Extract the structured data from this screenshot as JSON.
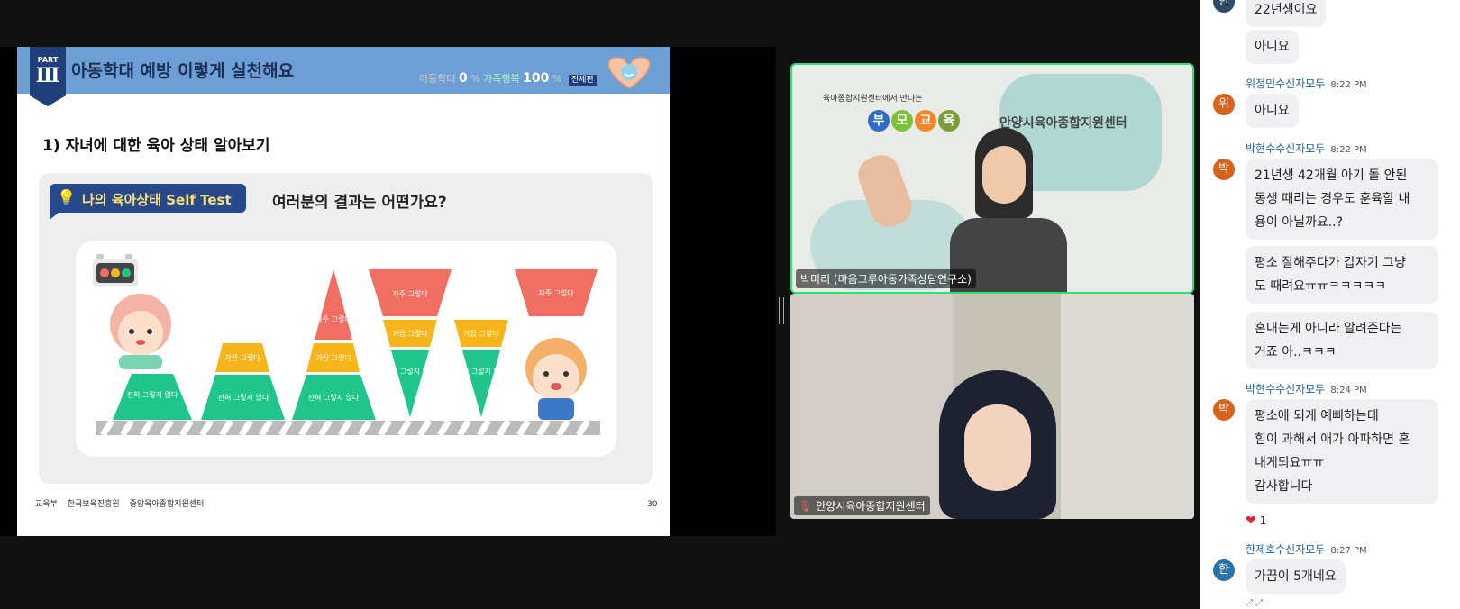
{
  "slide": {
    "part_label": "PART",
    "part_number": "Ⅲ",
    "title": "아동학대 예방 이렇게 실천해요",
    "stats": {
      "abuse_label": "아동학대",
      "abuse_value": "0",
      "abuse_unit": "%",
      "happy_label": "가족행복",
      "happy_value": "100",
      "happy_unit": "%",
      "badge": "전체편"
    },
    "subtitle": "1) 자녀에 대한 육아 상태 알아보기",
    "selftest_label": "나의 육아상태 Self Test",
    "question": "여러분의 결과는 어떤가요?",
    "shape_labels": {
      "never": "전혀 그렇지 않다",
      "sometimes": "가끔 그렇다",
      "often": "자주 그렇다",
      "never_split": "전혀 그렇지 않다"
    },
    "footer": [
      "교육부",
      "한국보육진흥원",
      "중앙육아종합지원센터"
    ],
    "page_number": "30"
  },
  "video": {
    "speaker_name": "박미리 (마음그루아동가족상담연구소)",
    "speaker_logo_small": "육아종합지원센터에서 만나는",
    "speaker_logo_chars": [
      "부",
      "모",
      "교",
      "육"
    ],
    "speaker_center_logo": "안양시육아종합지원센터",
    "second_name": "안양시육아종합지원센터"
  },
  "chat": {
    "messages": [
      {
        "avatar": "한",
        "text": "22년생이요"
      },
      {
        "text": "아니요"
      },
      {
        "sender": "위정민",
        "to_prefix": "수신자",
        "to": "모두",
        "time": "8:22 PM",
        "avatar": "위",
        "text": "아니요"
      },
      {
        "sender": "박현수",
        "to_prefix": "수신자",
        "to": "모두",
        "time": "8:22 PM",
        "avatar": "박",
        "text_lines": [
          "21년생 42개월 아기 돌 안된",
          "동생 때리는 경우도 훈육할 내",
          "용이 아닐까요..?"
        ]
      },
      {
        "text_lines": [
          "평소 잘해주다가 갑자기 그냥",
          "도 때려요ㅠㅠㅋㅋㅋㅋㅋ"
        ]
      },
      {
        "text_lines": [
          "혼내는게 아니라 알려준다는",
          "거죠 아..ㅋㅋㅋ"
        ]
      },
      {
        "sender": "박현수",
        "to_prefix": "수신자",
        "to": "모두",
        "time": "8:24 PM",
        "avatar": "박",
        "text_lines": [
          "평소에 되게 예뻐하는데",
          "힘이 과해서 애가 아파하면 혼",
          "내게되요ㅠㅠ",
          "감사합니다"
        ]
      },
      {
        "reaction_count": "1"
      },
      {
        "sender": "한제호",
        "to_prefix": "수신자",
        "to": "모두",
        "time": "8:27 PM",
        "avatar": "한",
        "text": "가끔이 5개네요"
      }
    ]
  },
  "colors": {
    "green": "#1fc58a",
    "yellow": "#f6b61b",
    "red": "#f06f62",
    "header_blue": "#6d9fd5",
    "navy": "#27488a"
  }
}
